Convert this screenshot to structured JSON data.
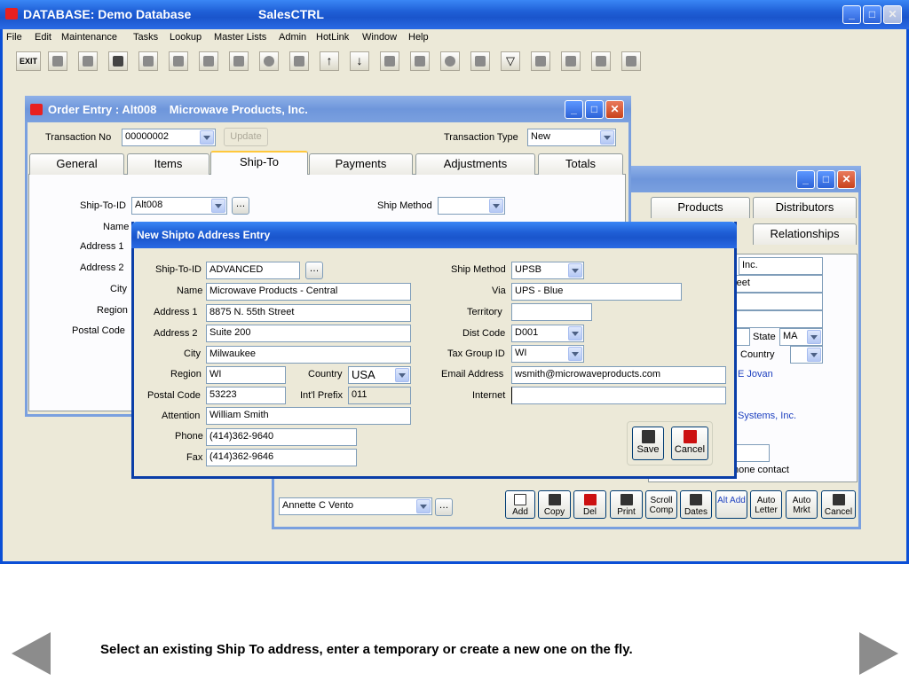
{
  "app": {
    "title_left": "DATABASE:  Demo Database",
    "title_center": "SalesCTRL",
    "menu": [
      "File",
      "Edit",
      "Maintenance",
      "Tasks",
      "Lookup",
      "Master Lists",
      "Admin",
      "HotLink",
      "Window",
      "Help"
    ],
    "exit_label": "EXIT"
  },
  "order_entry": {
    "title": "Order Entry : Alt008    Microwave Products, Inc.",
    "transaction_no_label": "Transaction No",
    "transaction_no": "00000002",
    "update_label": "Update",
    "transaction_type_label": "Transaction Type",
    "transaction_type": "New",
    "tabs": [
      "General",
      "Items",
      "Ship-To",
      "Payments",
      "Adjustments",
      "Totals"
    ],
    "shipto_id_label": "Ship-To-ID",
    "shipto_id": "Alt008",
    "ship_method_label": "Ship Method",
    "side_labels": [
      "Name",
      "Address 1",
      "Address 2",
      "City",
      "Region",
      "Postal Code"
    ]
  },
  "back_window": {
    "tabs": [
      "Products",
      "Distributors",
      "Relationships"
    ],
    "frag_inc": "Inc.",
    "frag_reet": "reet",
    "state_label": "State",
    "state_value": "MA",
    "country_label": "Country",
    "contact_link": "E Jovan",
    "systems_link": "Systems, Inc.",
    "phone_contact": "hone contact",
    "salesperson": "Annette C Vento",
    "buttons": [
      "Add",
      "Copy",
      "Del",
      "Print",
      "Scroll Comp",
      "Dates",
      "Alt Add",
      "Auto Letter",
      "Auto Mrkt",
      "Cancel"
    ]
  },
  "shipto_dialog": {
    "title": "New Shipto Address Entry",
    "labels": {
      "shipto_id": "Ship-To-ID",
      "name": "Name",
      "address1": "Address 1",
      "address2": "Address 2",
      "city": "City",
      "region": "Region",
      "country": "Country",
      "postal": "Postal Code",
      "intl": "Int'l Prefix",
      "attention": "Attention",
      "phone": "Phone",
      "fax": "Fax",
      "ship_method": "Ship Method",
      "via": "Via",
      "territory": "Territory",
      "dist_code": "Dist Code",
      "tax_group": "Tax Group ID",
      "email": "Email Address",
      "internet": "Internet"
    },
    "values": {
      "shipto_id": "ADVANCED",
      "name": "Microwave Products - Central",
      "address1": "8875 N. 55th Street",
      "address2": "Suite 200",
      "city": "Milwaukee",
      "region": "WI",
      "country": "USA",
      "postal": "53223",
      "intl": "011",
      "attention": "William Smith",
      "phone": "(414)362-9640",
      "fax": "(414)362-9646",
      "ship_method": "UPSB",
      "via": "UPS - Blue",
      "territory": "",
      "dist_code": "D001",
      "tax_group": "WI",
      "email": "wsmith@microwaveproducts.com",
      "internet": ""
    },
    "save_label": "Save",
    "cancel_label": "Cancel"
  },
  "caption": "Select an existing Ship To address, enter a temporary or create a new one on the fly.",
  "colors": {
    "title_blue": "#1f5fd6",
    "dialog_border": "#0a3ea8",
    "link_blue": "#1c3fbf",
    "arrow_gray": "#8c8c8c"
  }
}
